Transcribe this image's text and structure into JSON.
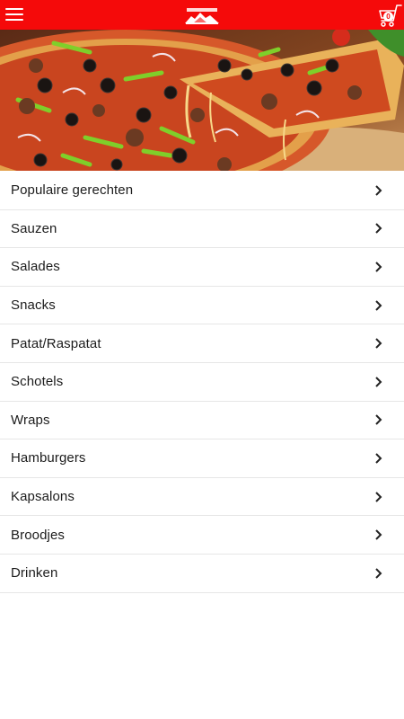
{
  "header": {
    "menu_icon": "hamburger-menu-icon",
    "logo": "pizza-logo",
    "cart_icon": "shopping-cart-icon",
    "cart_count": "0"
  },
  "hero": {
    "image": "pizza-photo"
  },
  "categories": [
    {
      "label": "Populaire gerechten"
    },
    {
      "label": "Sauzen"
    },
    {
      "label": "Salades"
    },
    {
      "label": "Snacks"
    },
    {
      "label": "Patat/Raspatat"
    },
    {
      "label": "Schotels"
    },
    {
      "label": "Wraps"
    },
    {
      "label": "Hamburgers"
    },
    {
      "label": "Kapsalons"
    },
    {
      "label": "Broodjes"
    },
    {
      "label": "Drinken"
    }
  ],
  "colors": {
    "brand": "#f50a0a",
    "divider": "#e6e6e6",
    "text": "#1c1c1c"
  }
}
